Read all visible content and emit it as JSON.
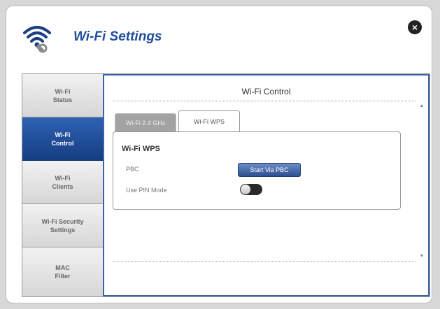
{
  "header": {
    "title": "Wi-Fi Settings",
    "close_label": "×"
  },
  "sidebar": {
    "items": [
      {
        "label": "Wi-Fi\nStatus",
        "active": false
      },
      {
        "label": "Wi-Fi\nControl",
        "active": true
      },
      {
        "label": "Wi-Fi\nClients",
        "active": false
      },
      {
        "label": "Wi-Fi Security\nSettings",
        "active": false
      },
      {
        "label": "MAC\nFilter",
        "active": false
      }
    ]
  },
  "main": {
    "title": "Wi-Fi Control",
    "tabs": [
      {
        "label": "Wi-Fi 2.4 GHz",
        "active": false
      },
      {
        "label": "Wi-Fi WPS",
        "active": true
      }
    ],
    "section_title": "Wi-Fi WPS",
    "pbc": {
      "label": "PBC",
      "button_label": "Start Via PBC"
    },
    "pin": {
      "label": "Use PIN Mode",
      "enabled": false
    }
  },
  "icons": {
    "logo": "wifi-settings-icon",
    "close": "close-icon",
    "scroll_up": "scroll-up-icon",
    "scroll_down": "scroll-down-icon"
  },
  "colors": {
    "accent": "#1f4f9a",
    "active_nav": "#163d82",
    "button": "#2c4f92"
  }
}
